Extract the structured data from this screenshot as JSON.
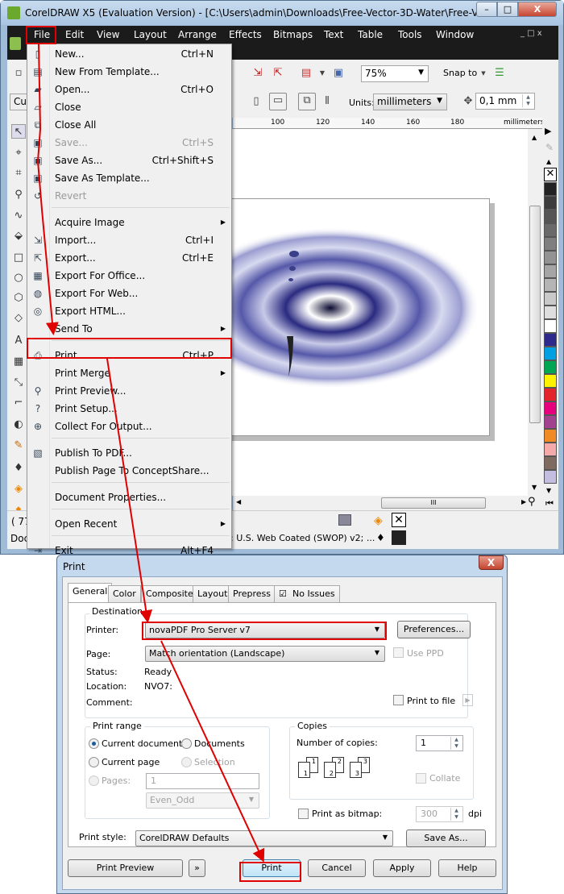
{
  "window": {
    "title": "CorelDRAW X5 (Evaluation Version) - [C:\\Users\\admin\\Downloads\\Free-Vector-3D-Water\\Free-Vector-3...",
    "minimize": "–",
    "maximize": "□",
    "close": "X",
    "doc_controls": "_ □ x"
  },
  "menubar": [
    "File",
    "Edit",
    "View",
    "Layout",
    "Arrange",
    "Effects",
    "Bitmaps",
    "Text",
    "Table",
    "Tools",
    "Window"
  ],
  "toolbar": {
    "zoom_value": "75%",
    "snap_to": "Snap to",
    "preset_partial": "Cus",
    "units_label": "Units:",
    "units_value": "millimeters",
    "nudge_value": "0,1 mm"
  },
  "ruler": {
    "ticks": [
      "100",
      "120",
      "140",
      "160",
      "180"
    ],
    "unit": "millimeters"
  },
  "palette": [
    "#222222",
    "#3c3c3c",
    "#555555",
    "#6a6a6a",
    "#7f7f7f",
    "#939393",
    "#a5a5a5",
    "#b5b5b5",
    "#c9c9c9",
    "#dedede",
    "#ffffff",
    "#2e2a8c",
    "#00a0e3",
    "#00a651",
    "#fff200",
    "#e3242b",
    "#e6007e",
    "#a2418d",
    "#f08a24",
    "#f3aaa9",
    "#7e6a5e",
    "#c3bddf"
  ],
  "status": {
    "coords_partial": "( 77",
    "doc_partial": "Doc",
    "color_profile": ": U.S. Web Coated (SWOP) v2; ..."
  },
  "file_menu": [
    {
      "label": "New...",
      "shortcut": "Ctrl+N",
      "icon": "new-document-icon"
    },
    {
      "label": "New From Template...",
      "shortcut": "",
      "icon": "template-icon"
    },
    {
      "label": "Open...",
      "shortcut": "Ctrl+O",
      "icon": "open-folder-icon"
    },
    {
      "label": "Close",
      "shortcut": "",
      "icon": "close-document-icon"
    },
    {
      "label": "Close All",
      "shortcut": "",
      "icon": "close-all-icon"
    },
    {
      "label": "Save...",
      "shortcut": "Ctrl+S",
      "icon": "save-icon",
      "disabled": true
    },
    {
      "label": "Save As...",
      "shortcut": "Ctrl+Shift+S",
      "icon": "save-as-icon"
    },
    {
      "label": "Save As Template...",
      "shortcut": "",
      "icon": "save-template-icon"
    },
    {
      "label": "Revert",
      "shortcut": "",
      "icon": "revert-icon",
      "disabled": true
    },
    {
      "sep": true
    },
    {
      "label": "Acquire Image",
      "shortcut": "",
      "submenu": true
    },
    {
      "label": "Import...",
      "shortcut": "Ctrl+I",
      "icon": "import-icon"
    },
    {
      "label": "Export...",
      "shortcut": "Ctrl+E",
      "icon": "export-icon"
    },
    {
      "label": "Export For Office...",
      "shortcut": "",
      "icon": "export-office-icon"
    },
    {
      "label": "Export For Web...",
      "shortcut": "",
      "icon": "export-web-icon"
    },
    {
      "label": "Export HTML...",
      "shortcut": "",
      "icon": "export-html-icon"
    },
    {
      "label": "Send To",
      "shortcut": "",
      "submenu": true
    },
    {
      "sep": true
    },
    {
      "label": "Print...",
      "shortcut": "Ctrl+P",
      "icon": "print-icon",
      "highlighted": true
    },
    {
      "label": "Print Merge",
      "shortcut": "",
      "submenu": true
    },
    {
      "label": "Print Preview...",
      "shortcut": "",
      "icon": "print-preview-icon"
    },
    {
      "label": "Print Setup...",
      "shortcut": "",
      "icon": "print-setup-icon"
    },
    {
      "label": "Collect For Output...",
      "shortcut": "",
      "icon": "collect-output-icon"
    },
    {
      "sep": true
    },
    {
      "label": "Publish To PDF...",
      "shortcut": "",
      "icon": "pdf-icon"
    },
    {
      "label": "Publish Page To ConceptShare...",
      "shortcut": ""
    },
    {
      "sep": true
    },
    {
      "label": "Document Properties...",
      "shortcut": ""
    },
    {
      "sep": true
    },
    {
      "label": "Open Recent",
      "shortcut": "",
      "submenu": true
    },
    {
      "sep": true
    },
    {
      "label": "Exit",
      "shortcut": "Alt+F4",
      "icon": "exit-icon"
    }
  ],
  "print_dialog": {
    "title": "Print",
    "close": "X",
    "tabs": [
      "General",
      "Color",
      "Composite",
      "Layout",
      "Prepress",
      "No Issues"
    ],
    "destination": {
      "title": "Destination",
      "printer_label": "Printer:",
      "printer_value": "novaPDF Pro Server v7",
      "preferences": "Preferences...",
      "page_label": "Page:",
      "page_value": "Match orientation (Landscape)",
      "use_ppd": "Use PPD",
      "status_label": "Status:",
      "status_value": "Ready",
      "location_label": "Location:",
      "location_value": "NVO7:",
      "comment_label": "Comment:",
      "print_to_file": "Print to file"
    },
    "print_range": {
      "title": "Print range",
      "current_document": "Current document",
      "documents": "Documents",
      "current_page": "Current page",
      "selection": "Selection",
      "pages_label": "Pages:",
      "pages_value": "1",
      "even_odd": "Even_Odd",
      "selected": "Current document"
    },
    "copies": {
      "title": "Copies",
      "number_label": "Number of copies:",
      "number_value": "1",
      "collate": "Collate",
      "collate_pages": [
        "1",
        "1",
        "2",
        "2",
        "3",
        "3"
      ]
    },
    "bitmap": {
      "label": "Print as bitmap:",
      "dpi_value": "300",
      "dpi_unit": "dpi"
    },
    "style": {
      "label": "Print style:",
      "value": "CorelDRAW Defaults",
      "save_as": "Save As..."
    },
    "buttons": {
      "preview": "Print Preview",
      "expand": "»",
      "print": "Print",
      "cancel": "Cancel",
      "apply": "Apply",
      "help": "Help"
    }
  },
  "annotation_color": "#e00000"
}
